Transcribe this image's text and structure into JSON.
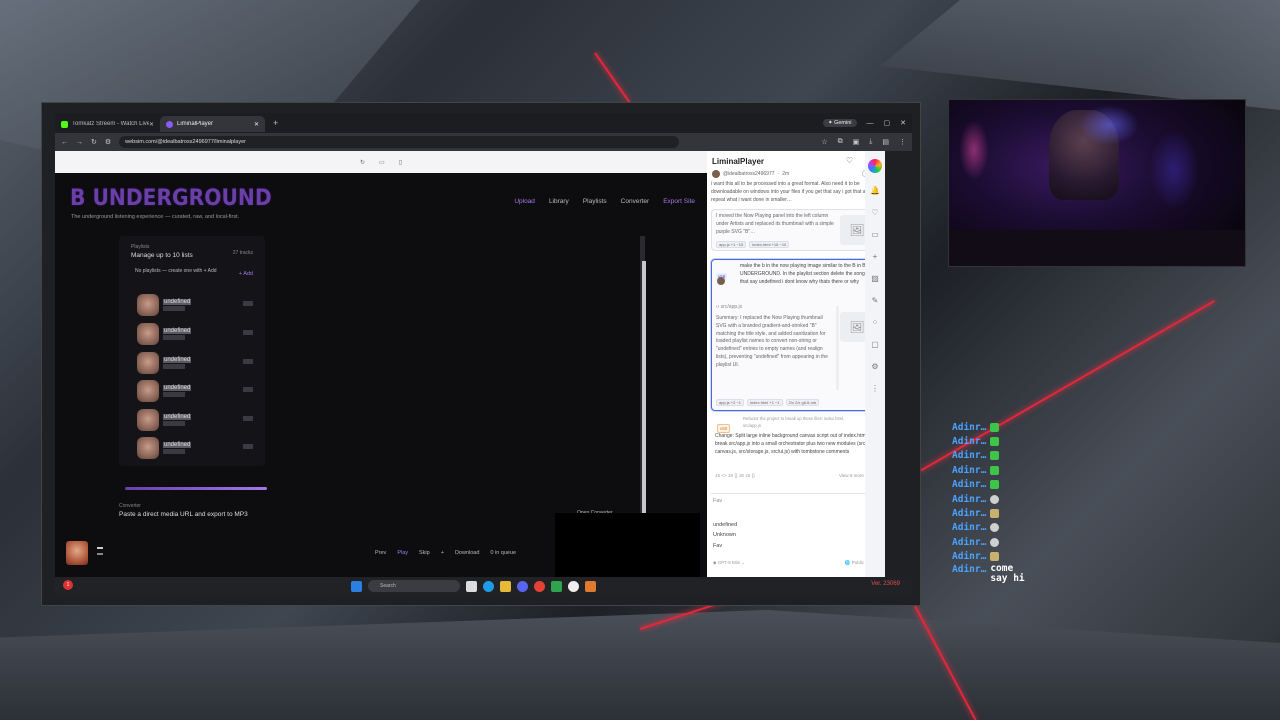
{
  "browser": {
    "tabs": [
      {
        "title": "Tomkatz Streem - Watch Live o",
        "active": false,
        "favicon_color": "#53fc18"
      },
      {
        "title": "LiminalPlayer",
        "active": true,
        "favicon_color": "#8a5cf5"
      }
    ],
    "gemini_label": "Gemini",
    "url": "websim.com/@idealbatross2496977/liminalplayer"
  },
  "site": {
    "logo": "B UNDERGROUND",
    "tagline": "The underground listening experience — curated, raw, and local-first.",
    "nav": [
      "Upload",
      "Library",
      "Playlists",
      "Converter",
      "Export Site"
    ],
    "playlists": {
      "label": "Playlists",
      "title": "Manage up to 10 lists",
      "count": "27 tracks",
      "empty": "No playlists — create one with + Add",
      "add": "+ Add"
    },
    "tracks": [
      "undefined",
      "undefined",
      "undefined",
      "undefined",
      "undefined",
      "undefined"
    ],
    "converter": {
      "label": "Converter",
      "title": "Paste a direct media URL and export to MP3",
      "open": "Open Converter"
    },
    "player": {
      "controls": [
        "Prev",
        "Play",
        "Skip",
        "+",
        "Download",
        "0 in queue"
      ]
    }
  },
  "panel": {
    "title": "LiminalPlayer",
    "author": "@idealbatross2496977",
    "time": "2m",
    "post_button": "Post",
    "user_msg_1": "i want this all to be processed into a great format. Also need it to be downloadable on windows into your files if you get that say i got that and repeat what i want done in smaller…",
    "card1_text": "I moved the Now Playing panel into the left column under Artists and replaced its thumbnail with a simple purple SVG \"B\"…",
    "card1_chips": [
      "app.js +1 −15",
      "index.html +16 −10"
    ],
    "v_badge_1": "v58",
    "user_msg_2": "make the b in the now playing image similar to the B in B UNDERGROUND. In the playlist section delete the songs that say undefined i dont know why thats there or why",
    "file_path": "src/app.js",
    "summary": "Summary: I replaced the Now Playing thumbnail SVG with a branded gradient-and-stroked \"B\" matching the title style, and added sanitization for loaded playlist names to convert non-string or \"undefined\" entries to empty names (and realign lists), preventing \"undefined\" from appearing in the playlist UI.",
    "card2_chips": [
      "app.js +2 −1",
      "index.html +1 −1",
      "2/x 2/x git-5-mb"
    ],
    "v_badge_2": "v60",
    "refactor_note": "Refactor the project to break up these files: index.html, src/app.js",
    "change_text": "Change: Split large inline background canvas script out of index.html and break src/app.js into a small orchestrator plus two new modules (src/bg-canvas.js, src/storage.js, src/ui.js) with tombstone comments",
    "view_more": "View 6 more",
    "file_icons": "JS <> JS {} JS JS {}",
    "input_placeholder": "Fav",
    "suggestions": [
      "undefined",
      "Unknown",
      "Fav"
    ],
    "model": "GPT-5 Mini",
    "visibility": "Public"
  },
  "taskbar": {
    "search": "Search",
    "version": "Ver. 23069",
    "notif": "1"
  },
  "chat": [
    {
      "name": "Adinr…",
      "emote": "green",
      "msg": ""
    },
    {
      "name": "Adinr…",
      "emote": "green",
      "msg": ""
    },
    {
      "name": "Adinr…",
      "emote": "green",
      "msg": ""
    },
    {
      "name": "Adinr…",
      "emote": "green",
      "msg": ""
    },
    {
      "name": "Adinr…",
      "emote": "green",
      "msg": ""
    },
    {
      "name": "Adinr…",
      "emote": "gray",
      "msg": ""
    },
    {
      "name": "Adinr…",
      "emote": "tan",
      "msg": ""
    },
    {
      "name": "Adinr…",
      "emote": "gray",
      "msg": ""
    },
    {
      "name": "Adinr…",
      "emote": "gray",
      "msg": ""
    },
    {
      "name": "Adinr…",
      "emote": "tan",
      "msg": ""
    },
    {
      "name": "Adinr…",
      "emote": "none",
      "msg": "come say hi"
    }
  ],
  "colors": {
    "accent_purple": "#a27ae8",
    "logo_purple": "#6a3fa8",
    "chat_name": "#4aa3ff",
    "red_accent": "#e0283a"
  }
}
